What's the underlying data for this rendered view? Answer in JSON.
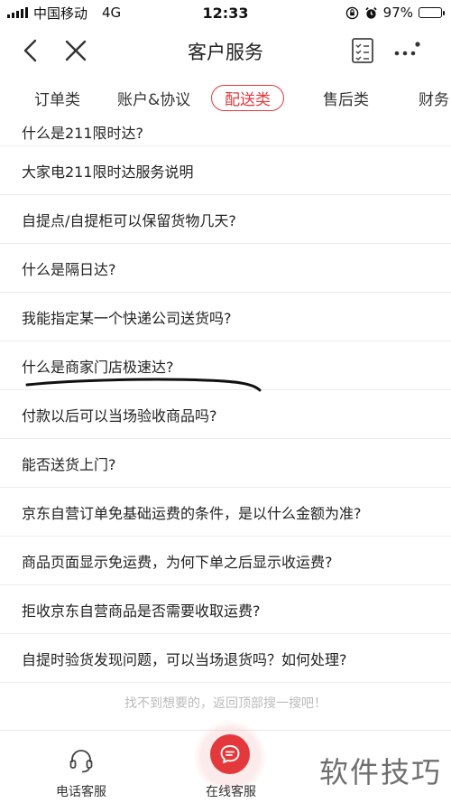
{
  "status_bar": {
    "carrier": "中国移动",
    "network": "4G",
    "time": "12:33",
    "battery_percent": "97%",
    "battery_level": 0.97
  },
  "nav": {
    "title": "客户服务"
  },
  "tabs": [
    {
      "label": "订单类",
      "active": false
    },
    {
      "label": "账户&协议",
      "active": false
    },
    {
      "label": "配送类",
      "active": true
    },
    {
      "label": "售后类",
      "active": false
    },
    {
      "label": "财务",
      "active": false
    }
  ],
  "questions": [
    "什么是211限时达?",
    "大家电211限时达服务说明",
    "自提点/自提柜可以保留货物几天?",
    "什么是隔日达?",
    "我能指定某一个快递公司送货吗?",
    "什么是商家门店极速达?",
    "付款以后可以当场验收商品吗?",
    "能否送货上门?",
    "京东自营订单免基础运费的条件，是以什么金额为准?",
    "商品页面显示免运费，为何下单之后显示收运费?",
    "拒收京东自营商品是否需要收取运费?",
    "自提时验货发现问题，可以当场退货吗？如何处理?"
  ],
  "hint": "找不到想要的，返回顶部搜一搜吧！",
  "bottom_bar": {
    "phone_label": "电话客服",
    "online_label": "在线客服"
  },
  "watermark": "软件技巧",
  "colors": {
    "accent": "#e4393c"
  }
}
